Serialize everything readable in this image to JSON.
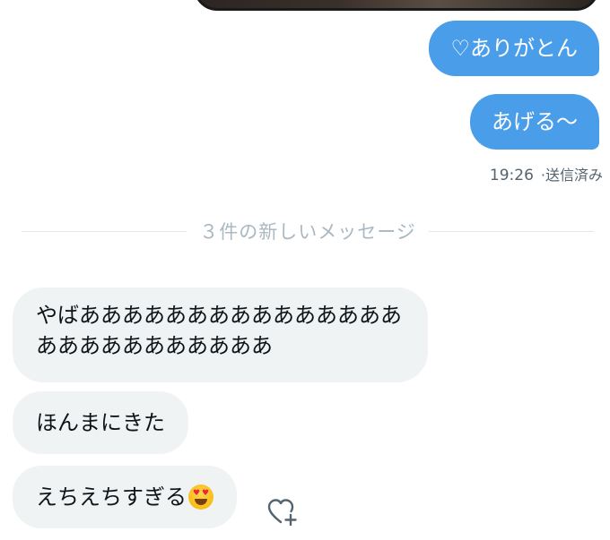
{
  "sent_messages": [
    {
      "text": "♡ありがとん"
    },
    {
      "text": "あげる〜"
    }
  ],
  "sent_meta": {
    "time": "19:26",
    "status": "·送信済み"
  },
  "divider": {
    "label": "３件の新しいメッセージ"
  },
  "received_messages": [
    {
      "text": "やばああああああああああああああああああああああああああ"
    },
    {
      "text": "ほんまにきた"
    },
    {
      "text": "えちえちすぎる",
      "emoji": "heart-eyes-emoji"
    }
  ],
  "reaction_button": {
    "icon": "heart-plus-icon"
  },
  "colors": {
    "sent_bubble": "#4a9de8",
    "received_bubble": "#eff3f4",
    "meta_text": "#536471",
    "divider_text": "#aab8c2"
  }
}
